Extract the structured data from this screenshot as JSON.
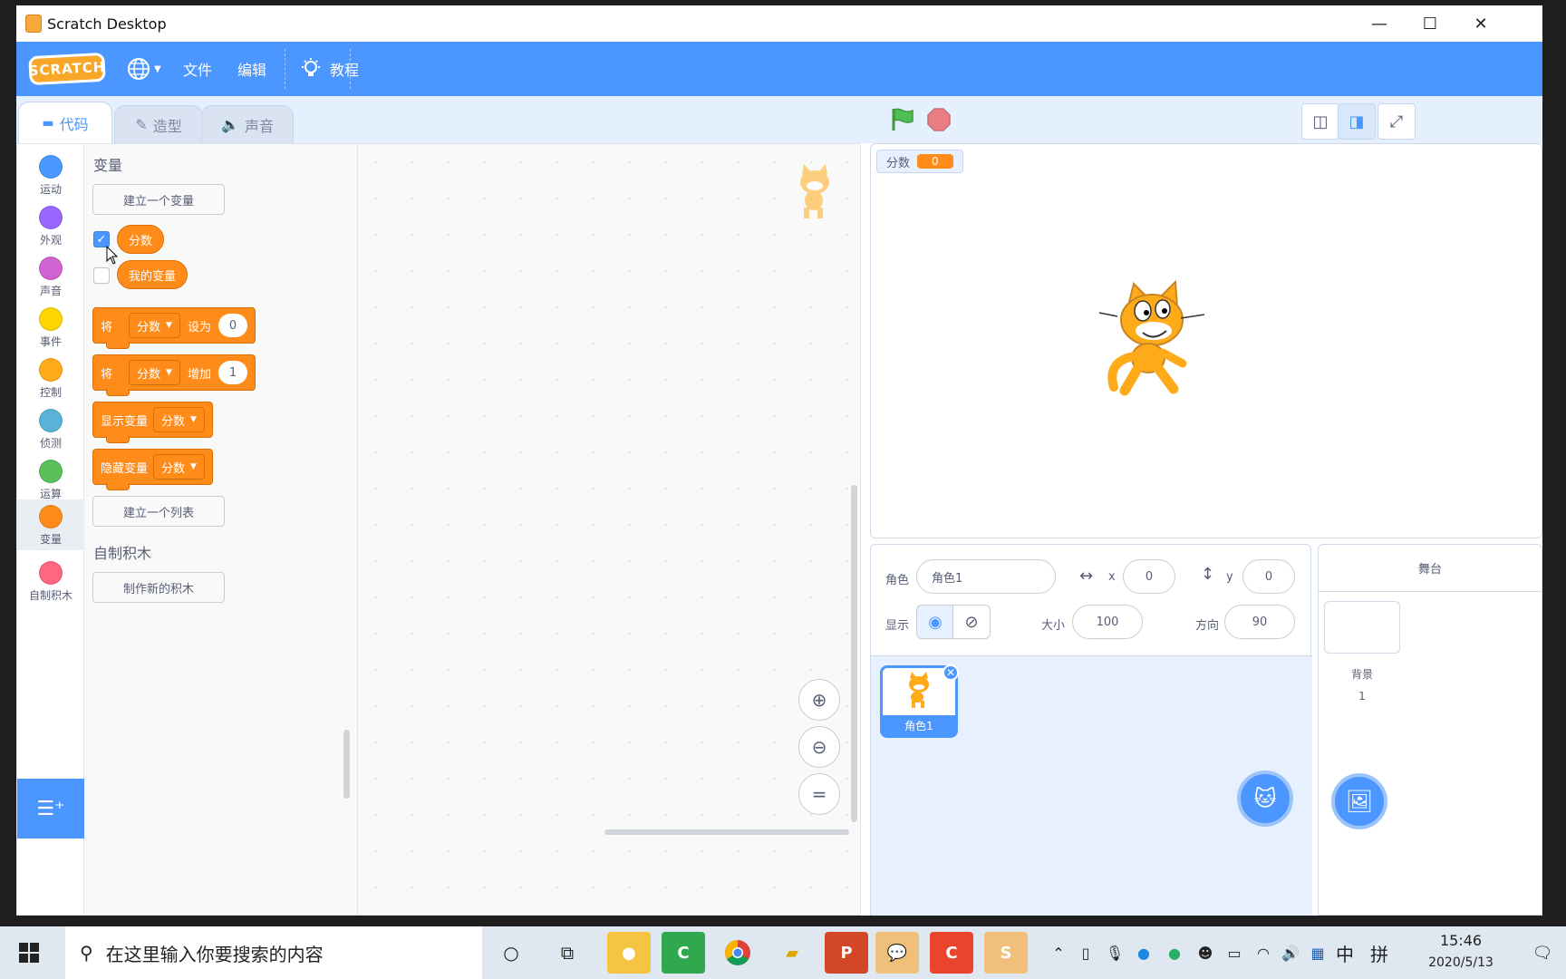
{
  "window": {
    "title": "Scratch Desktop",
    "minimize": "—",
    "maximize": "☐",
    "close": "✕"
  },
  "menubar": {
    "logo": "SCRATCH",
    "file": "文件",
    "edit": "编辑",
    "tutorials": "教程"
  },
  "tabs": {
    "code": "代码",
    "costumes": "造型",
    "sounds": "声音"
  },
  "categories": [
    {
      "label": "运动",
      "color": "#4c97ff"
    },
    {
      "label": "外观",
      "color": "#9966ff"
    },
    {
      "label": "声音",
      "color": "#cf63cf"
    },
    {
      "label": "事件",
      "color": "#ffd500"
    },
    {
      "label": "控制",
      "color": "#ffab19"
    },
    {
      "label": "侦测",
      "color": "#5cb1d6"
    },
    {
      "label": "运算",
      "color": "#59c059"
    },
    {
      "label": "变量",
      "color": "#ff8c1a"
    },
    {
      "label": "自制积木",
      "color": "#ff6680"
    }
  ],
  "palette": {
    "variables_heading": "变量",
    "make_variable": "建立一个变量",
    "var1": "分数",
    "var2": "我的变量",
    "set_block": {
      "prefix": "将",
      "var": "分数",
      "op": "设为",
      "value": "0"
    },
    "change_block": {
      "prefix": "将",
      "var": "分数",
      "op": "增加",
      "value": "1"
    },
    "show_block": {
      "label": "显示变量",
      "var": "分数"
    },
    "hide_block": {
      "label": "隐藏变量",
      "var": "分数"
    },
    "make_list": "建立一个列表",
    "myblocks_heading": "自制积木",
    "make_block": "制作新的积木"
  },
  "stage": {
    "monitor_label": "分数",
    "monitor_value": "0"
  },
  "sprite_info": {
    "sprite_label": "角色",
    "sprite_name": "角色1",
    "x_label": "x",
    "x_value": "0",
    "y_label": "y",
    "y_value": "0",
    "show_label": "显示",
    "size_label": "大小",
    "size_value": "100",
    "direction_label": "方向",
    "direction_value": "90",
    "thumb_label": "角色1"
  },
  "stage_panel": {
    "title": "舞台",
    "backdrops_label": "背景",
    "backdrops_count": "1"
  },
  "taskbar": {
    "search_placeholder": "在这里输入你要搜索的内容",
    "time": "15:46",
    "date": "2020/5/13",
    "ime1": "中",
    "ime2": "拼"
  },
  "colors": {
    "accent": "#4c97ff",
    "variables": "#ff8c1a"
  }
}
